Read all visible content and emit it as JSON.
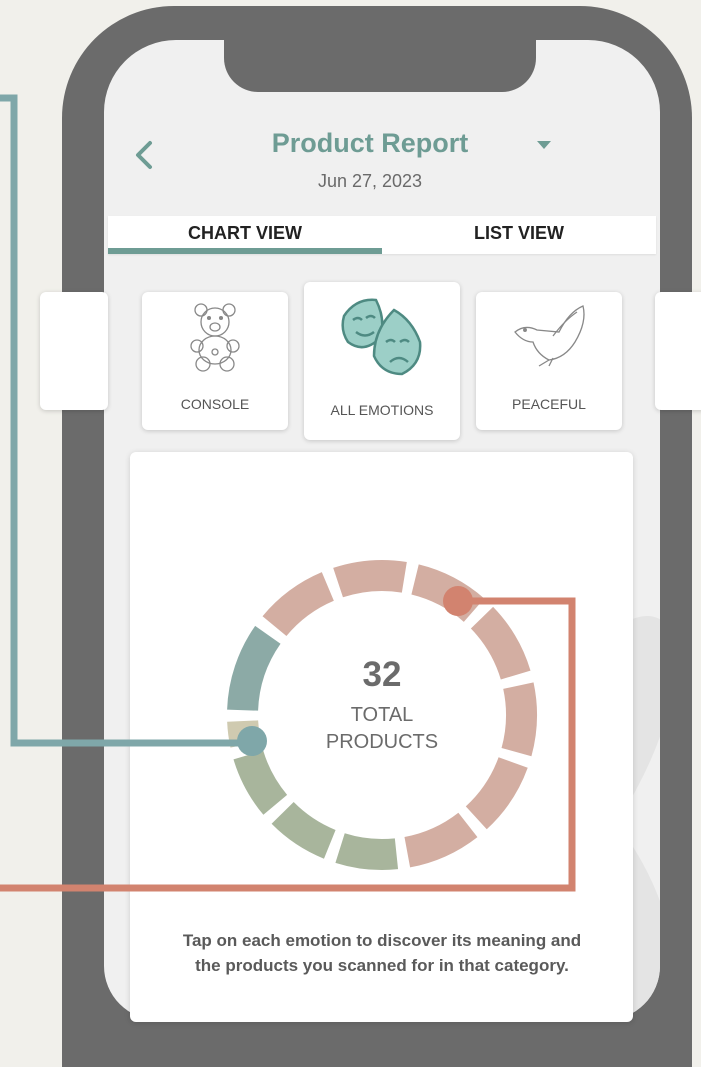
{
  "header": {
    "title": "Product Report",
    "date": "Jun 27, 2023"
  },
  "tabs": [
    {
      "label": "CHART VIEW",
      "active": true
    },
    {
      "label": "LIST VIEW",
      "active": false
    }
  ],
  "emotions": [
    {
      "label": "CONSOLE",
      "icon": "teddy-bear-icon"
    },
    {
      "label": "ALL EMOTIONS",
      "icon": "theater-masks-icon"
    },
    {
      "label": "PEACEFUL",
      "icon": "dove-icon"
    }
  ],
  "chart_data": {
    "type": "pie",
    "center_value": "32",
    "center_label": [
      "TOTAL",
      "PRODUCTS"
    ],
    "segments": [
      {
        "color": "#8caaa6",
        "value": 1.2
      },
      {
        "color": "#d3aea2",
        "value": 1
      },
      {
        "color": "#d3aea2",
        "value": 1
      },
      {
        "color": "#d3aea2",
        "value": 1
      },
      {
        "color": "#d3aea2",
        "value": 1
      },
      {
        "color": "#d3aea2",
        "value": 1
      },
      {
        "color": "#d3aea2",
        "value": 1
      },
      {
        "color": "#d3aea2",
        "value": 1
      },
      {
        "color": "#a8b59c",
        "value": 0.85
      },
      {
        "color": "#a8b59c",
        "value": 0.85
      },
      {
        "color": "#a8b59c",
        "value": 0.85
      },
      {
        "color": "#cfcab0",
        "value": 0.35
      }
    ]
  },
  "description": "Tap on each emotion to discover its meaning and the products you scanned for in that category.",
  "colors": {
    "accent": "#6e9c94",
    "callout_teal": "#7fa7a9",
    "callout_coral": "#d2836f"
  }
}
